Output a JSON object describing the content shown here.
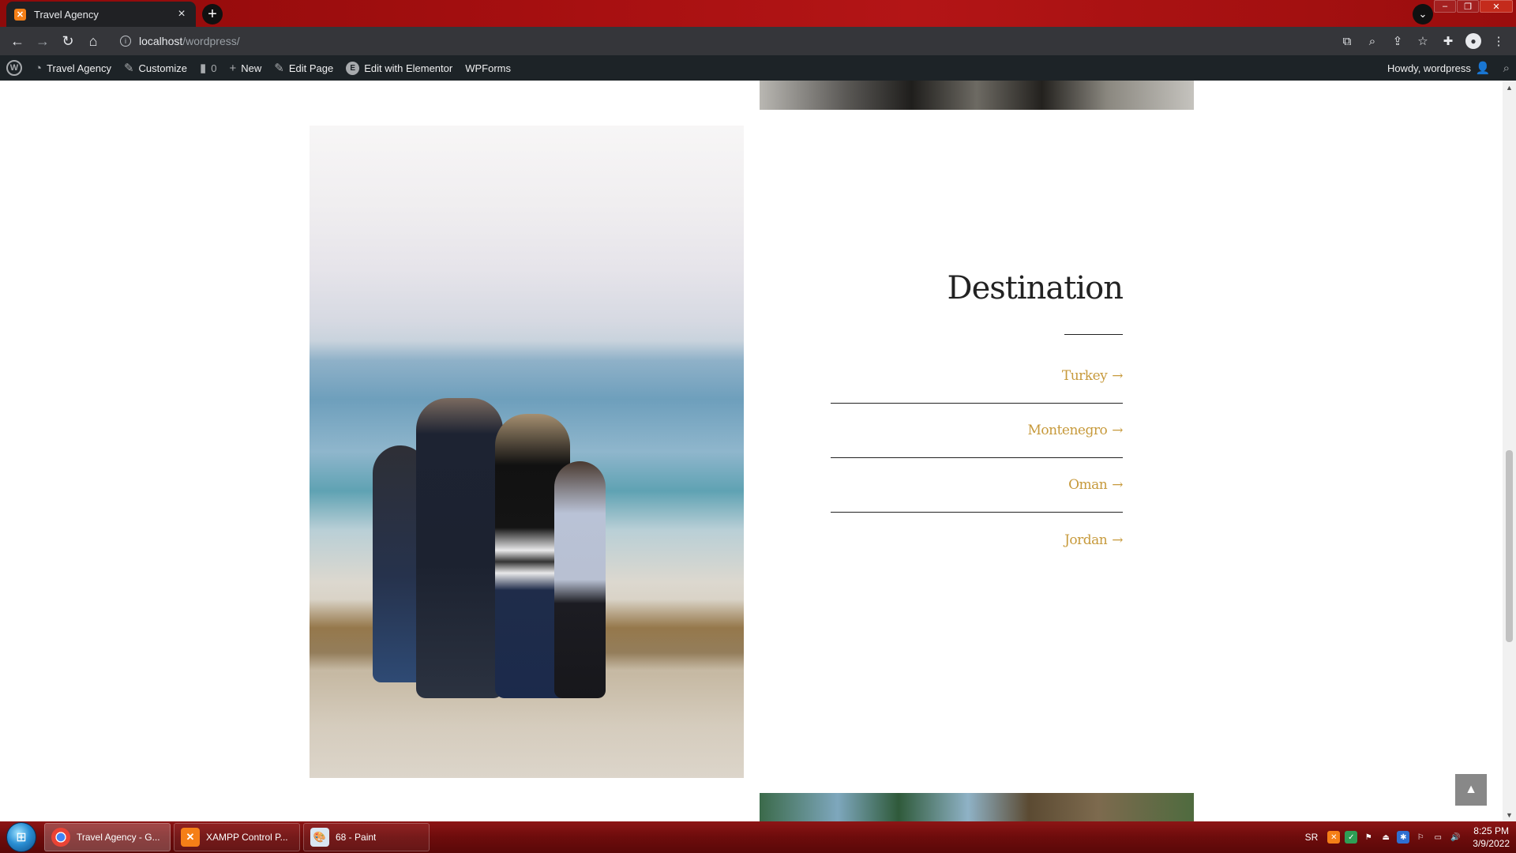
{
  "browser": {
    "tab_title": "Travel Agency",
    "tab_close": "×",
    "new_tab": "+",
    "url_host": "localhost",
    "url_path": "/wordpress/",
    "icons": [
      "back-icon",
      "forward-icon",
      "reload-icon",
      "home-icon",
      "info-icon",
      "translate-icon",
      "zoom-icon",
      "share-icon",
      "bookmark-star-icon",
      "extensions-icon",
      "profile-icon",
      "menu-icon"
    ]
  },
  "wpbar": {
    "site_name": "Travel Agency",
    "customize": "Customize",
    "comments_count": "0",
    "new": "New",
    "edit_page": "Edit Page",
    "edit_elementor": "Edit with Elementor",
    "wpforms": "WPForms",
    "howdy": "Howdy, wordpress"
  },
  "content": {
    "destination_title": "Destination",
    "destinations": [
      {
        "label": "Turkey",
        "arrow": "→"
      },
      {
        "label": "Montenegro",
        "arrow": "→"
      },
      {
        "label": "Oman",
        "arrow": "→"
      },
      {
        "label": "Jordan",
        "arrow": "→"
      }
    ],
    "accent_color": "#c79a3c"
  },
  "taskbar": {
    "tasks": [
      {
        "label": "Travel Agency - G..."
      },
      {
        "label": "XAMPP Control P..."
      },
      {
        "label": "68 - Paint"
      }
    ],
    "lang": "SR",
    "time": "8:25 PM",
    "date": "3/9/2022"
  }
}
